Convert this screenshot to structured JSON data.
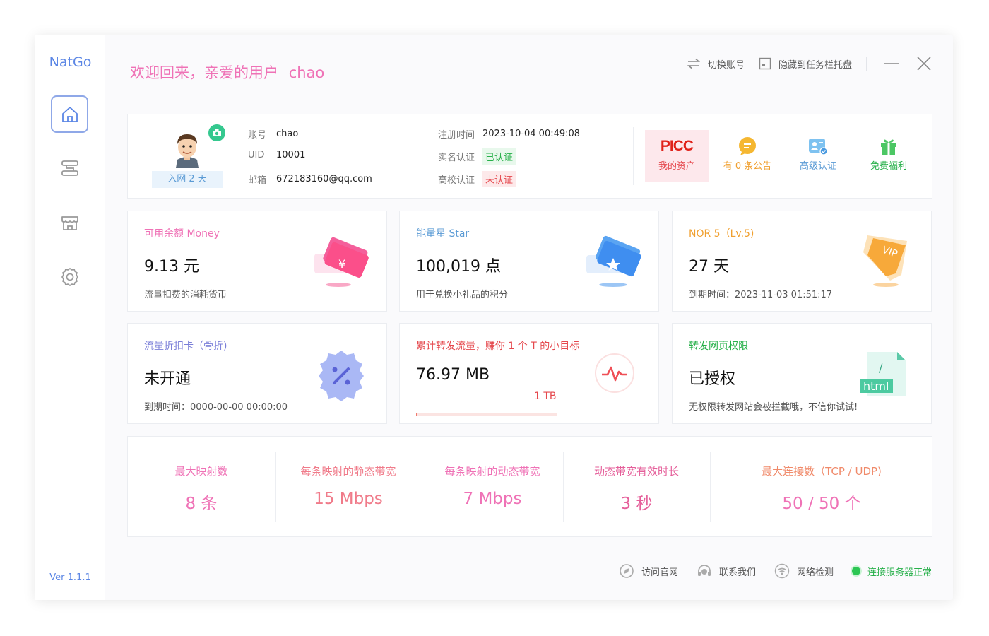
{
  "app": {
    "logo": "NatGo",
    "version": "Ver 1.1.1"
  },
  "sidebar": {
    "items": [
      {
        "name": "home",
        "icon": "home-icon",
        "active": true
      },
      {
        "name": "tunnels",
        "icon": "list-icon",
        "active": false
      },
      {
        "name": "store",
        "icon": "store-icon",
        "active": false
      },
      {
        "name": "settings",
        "icon": "gear-icon",
        "active": false
      }
    ]
  },
  "header": {
    "welcome_prefix": "欢迎回来，亲爱的用户",
    "username": "chao",
    "switch_account": "切换账号",
    "hide_to_tray": "隐藏到任务栏托盘"
  },
  "profile": {
    "join_days": "入网 2 天",
    "account_label": "账号",
    "account": "chao",
    "uid_label": "UID",
    "uid": "10001",
    "email_label": "邮箱",
    "email": "672183160@qq.com",
    "reg_time_label": "注册时间",
    "reg_time": "2023-10-04 00:49:08",
    "realname_label": "实名认证",
    "realname_status": "已认证",
    "campus_label": "高校认证",
    "campus_status": "未认证",
    "quick": {
      "picc_logo": "PICC",
      "assets": "我的资产",
      "notices": "有 0 条公告",
      "advanced_auth": "高级认证",
      "free_benefit": "免费福利"
    }
  },
  "stats": [
    {
      "label": "可用余额 Money",
      "value": "9.13 元",
      "sub": "流量扣费的消耗货币",
      "color": "#ef72b6"
    },
    {
      "label": "能量星 Star",
      "value": "100,019 点",
      "sub": "用于兑换小礼品的积分",
      "color": "#5b9bd5"
    },
    {
      "label": "NOR 5（Lv.5)",
      "value": "27 天",
      "sub": "到期时间：2023-11-03 01:51:17",
      "color": "#f0a030"
    },
    {
      "label": "流量折扣卡（骨折)",
      "value": "未开通",
      "sub": "到期时间：0000-00-00 00:00:00",
      "color": "#7b7fd8"
    },
    {
      "label": "累计转发流量，赚你 1 个 T 的小目标",
      "value": "76.97 MB",
      "sub": "1 TB",
      "color": "#e5484d",
      "progress": 0.0001
    },
    {
      "label": "转发网页权限",
      "value": "已授权",
      "sub": "无权限转发网站会被拦截哦，不信你试试!",
      "color": "#27b04a"
    }
  ],
  "icons": {
    "vip_text": "VIP",
    "html_text": "html",
    "slash_text": "/"
  },
  "limits": [
    {
      "title": "最大映射数",
      "value": "8 条"
    },
    {
      "title": "每条映射的静态带宽",
      "value": "15 Mbps"
    },
    {
      "title": "每条映射的动态带宽",
      "value": "7 Mbps"
    },
    {
      "title": "动态带宽有效时长",
      "value": "3 秒"
    },
    {
      "title": "最大连接数（TCP / UDP)",
      "value": "50 / 50 个"
    }
  ],
  "footer": {
    "website": "访问官网",
    "contact": "联系我们",
    "network_check": "网络检测",
    "server_status": "连接服务器正常"
  }
}
